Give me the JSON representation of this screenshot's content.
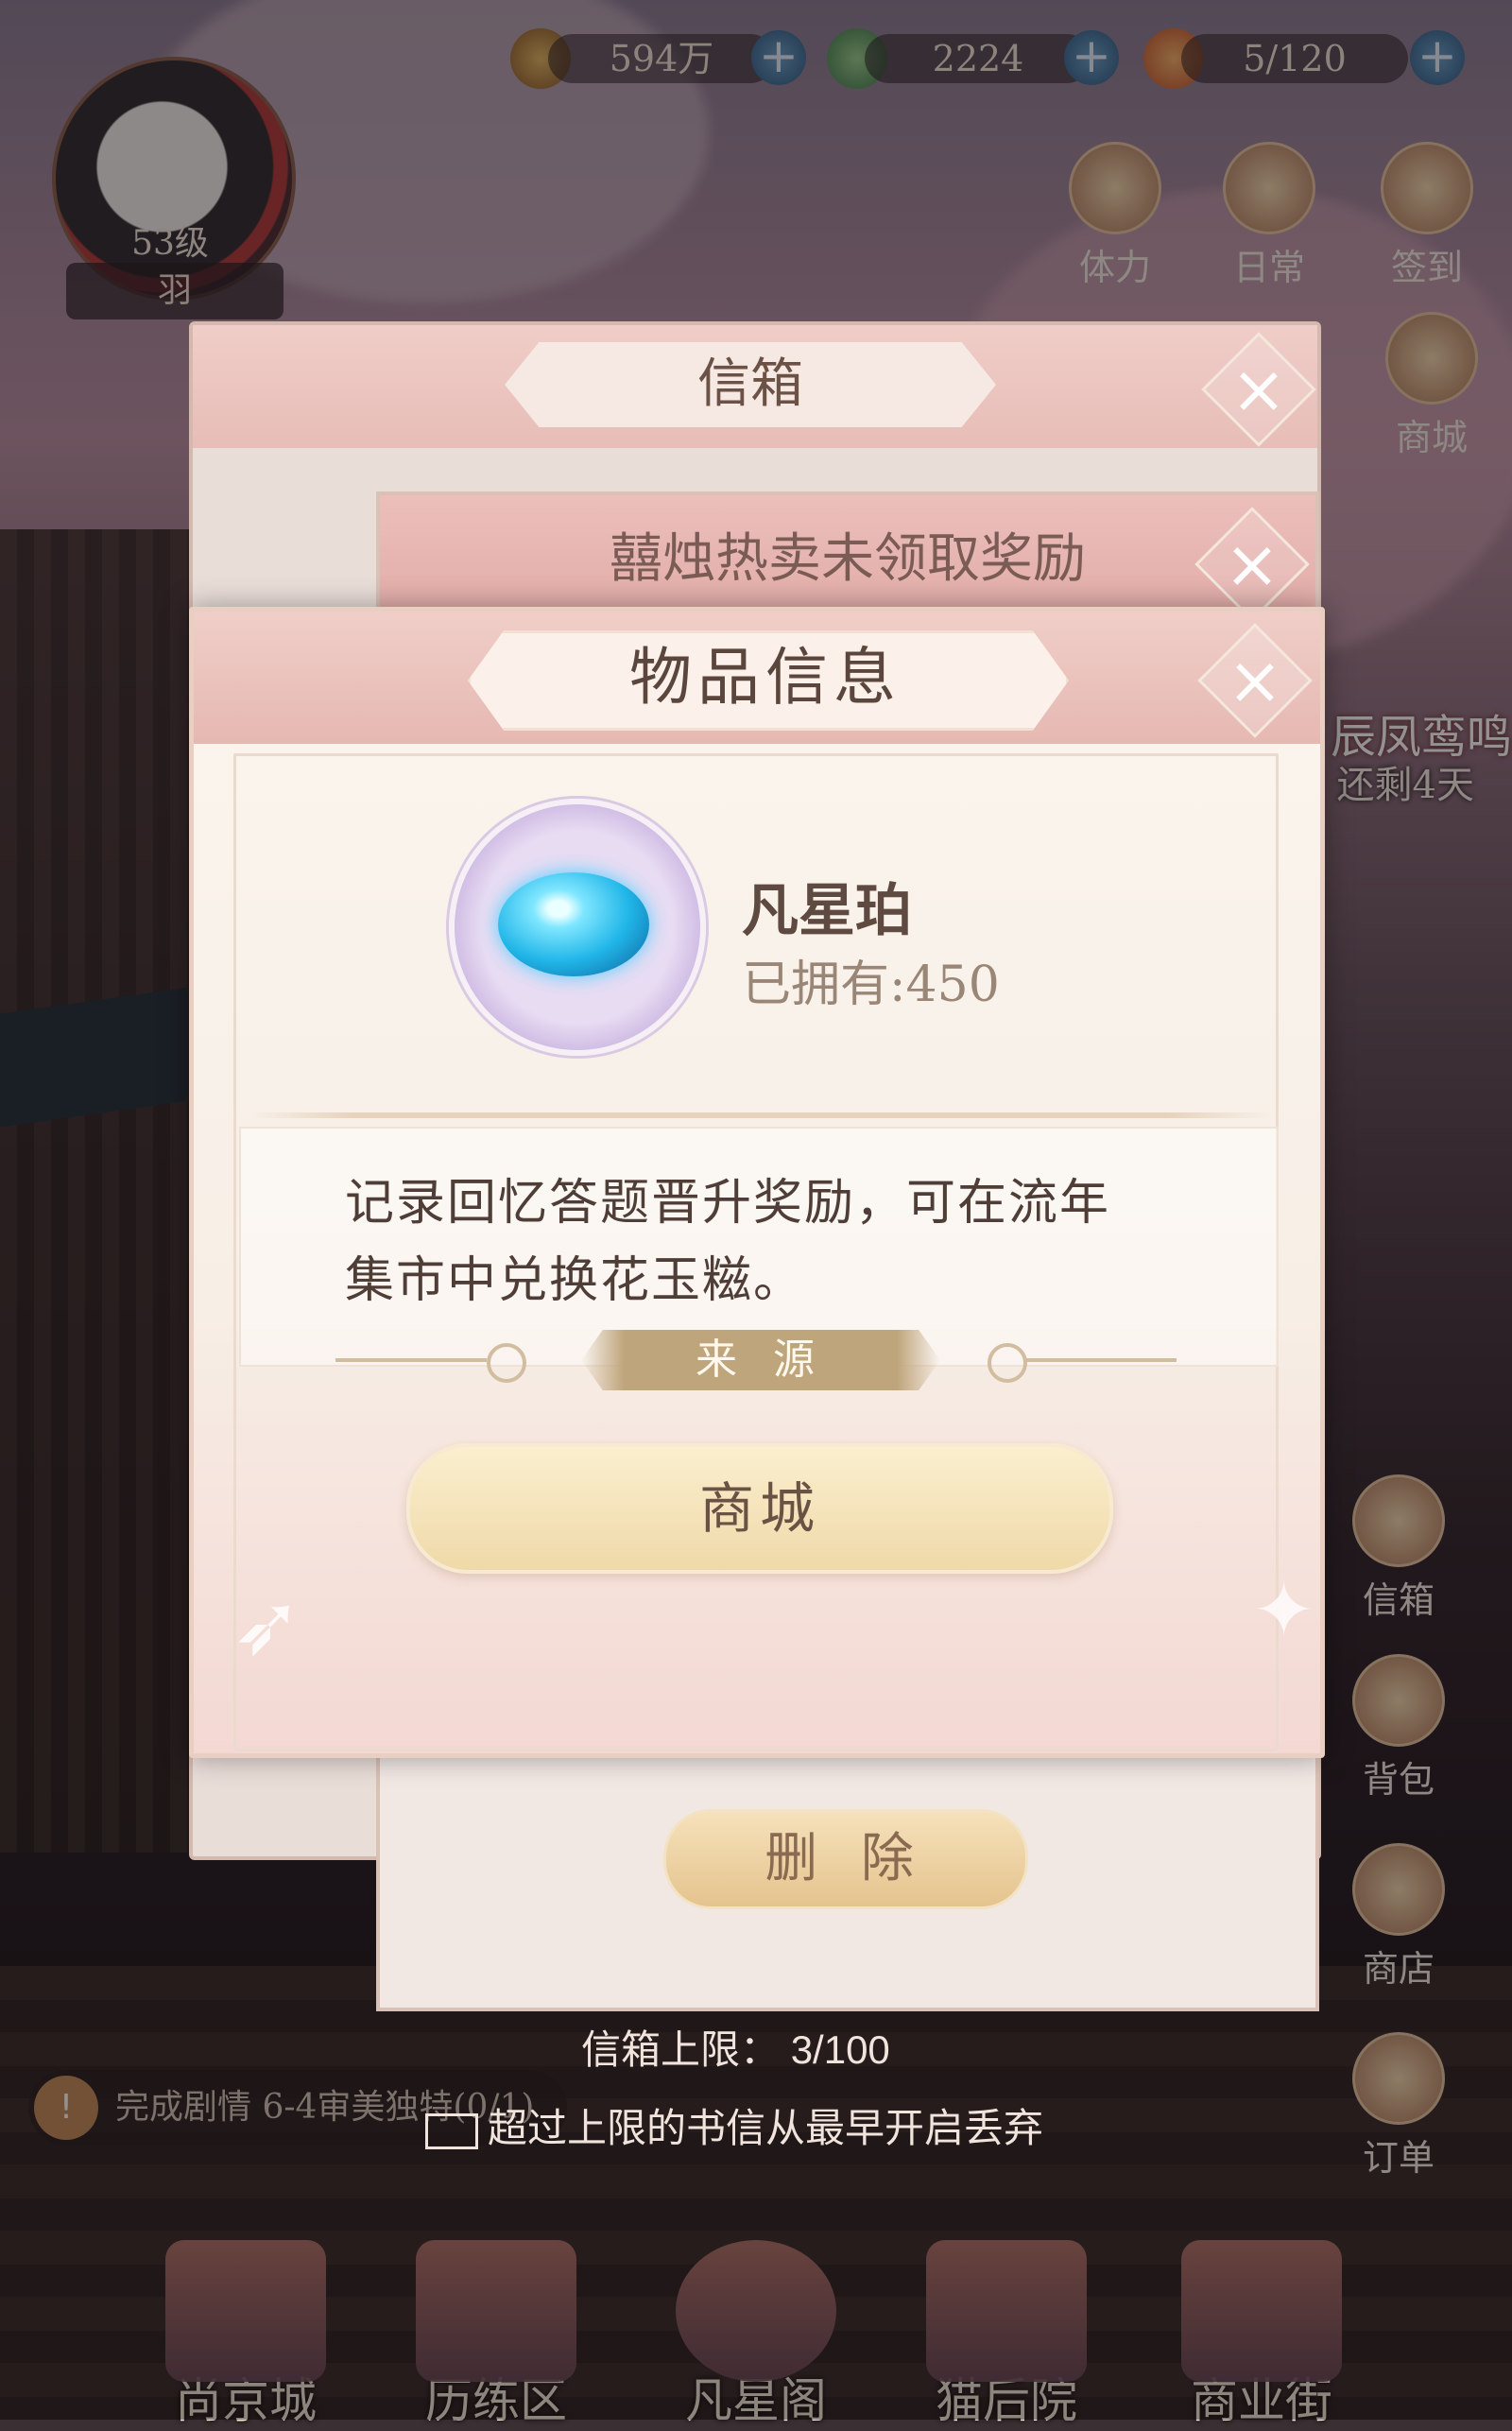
{
  "resources": [
    {
      "value": "594万",
      "icon": "paw-coin-icon"
    },
    {
      "value": "2224",
      "icon": "jade-icon"
    },
    {
      "value": "5/120",
      "icon": "stamina-icon"
    }
  ],
  "player": {
    "level": "53级",
    "name": "羽"
  },
  "side_top": [
    {
      "label": "体力",
      "icon": "stamina-bun-icon"
    },
    {
      "label": "日常",
      "icon": "daily-scroll-icon"
    },
    {
      "label": "签到",
      "icon": "checkin-icon"
    },
    {
      "label": "商城",
      "icon": "mall-icon"
    }
  ],
  "event": {
    "title": "辰凤鸾鸣",
    "remaining": "还剩4天"
  },
  "side_bottom": [
    {
      "label": "信箱",
      "icon": "mail-icon"
    },
    {
      "label": "背包",
      "icon": "bag-icon"
    },
    {
      "label": "商店",
      "icon": "shop-icon"
    },
    {
      "label": "订单",
      "icon": "order-icon"
    }
  ],
  "mailbox": {
    "title": "信箱",
    "limit_label": "信箱上限：",
    "limit_value": "3/100",
    "note": "超过上限的书信从最早开启丢弃"
  },
  "reward_panel": {
    "title": "囍烛热卖未领取奖励",
    "delete_label": "删 除"
  },
  "task": {
    "text": "完成剧情 6-4审美独特(0/1)"
  },
  "dialog": {
    "title": "物品信息",
    "item_name": "凡星珀",
    "owned_label": "已拥有:",
    "owned_value": "450",
    "description": "记录回忆答题晋升奖励，可在流年集市中兑换花玉糍。",
    "source_label": "来 源",
    "source_button": "商城"
  },
  "nav": [
    {
      "label": "尚京城",
      "icon": "city-icon"
    },
    {
      "label": "历练区",
      "icon": "training-icon"
    },
    {
      "label": "凡星阁",
      "icon": "star-pavilion-icon"
    },
    {
      "label": "猫后院",
      "icon": "cat-yard-icon"
    },
    {
      "label": "商业街",
      "icon": "street-icon"
    }
  ],
  "colors": {
    "accent": "#e6b8b2",
    "button_gold": "#efd9a8",
    "text_brown": "#5b463d"
  }
}
